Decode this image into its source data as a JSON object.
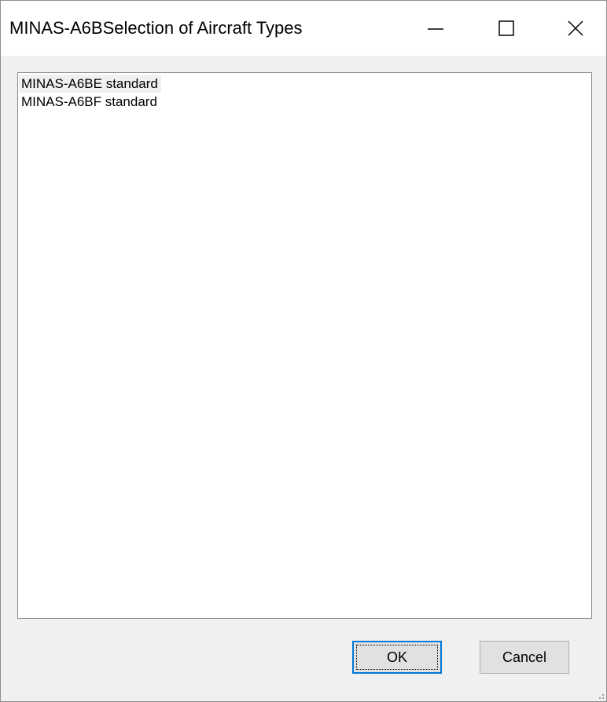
{
  "window": {
    "title": "MINAS-A6BSelection of Aircraft Types",
    "controls": {
      "minimize_icon": "minimize-icon",
      "maximize_icon": "maximize-icon",
      "close_icon": "close-icon"
    }
  },
  "list": {
    "items": [
      {
        "label": "MINAS-A6BE standard",
        "selected": true
      },
      {
        "label": "MINAS-A6BF standard",
        "selected": false
      }
    ]
  },
  "buttons": {
    "ok_label": "OK",
    "cancel_label": "Cancel"
  },
  "colors": {
    "titlebar_bg": "#ffffff",
    "window_bg": "#f0f0f0",
    "focus_accent": "#0078d7",
    "selected_item_bg": "#f0f0f0"
  }
}
